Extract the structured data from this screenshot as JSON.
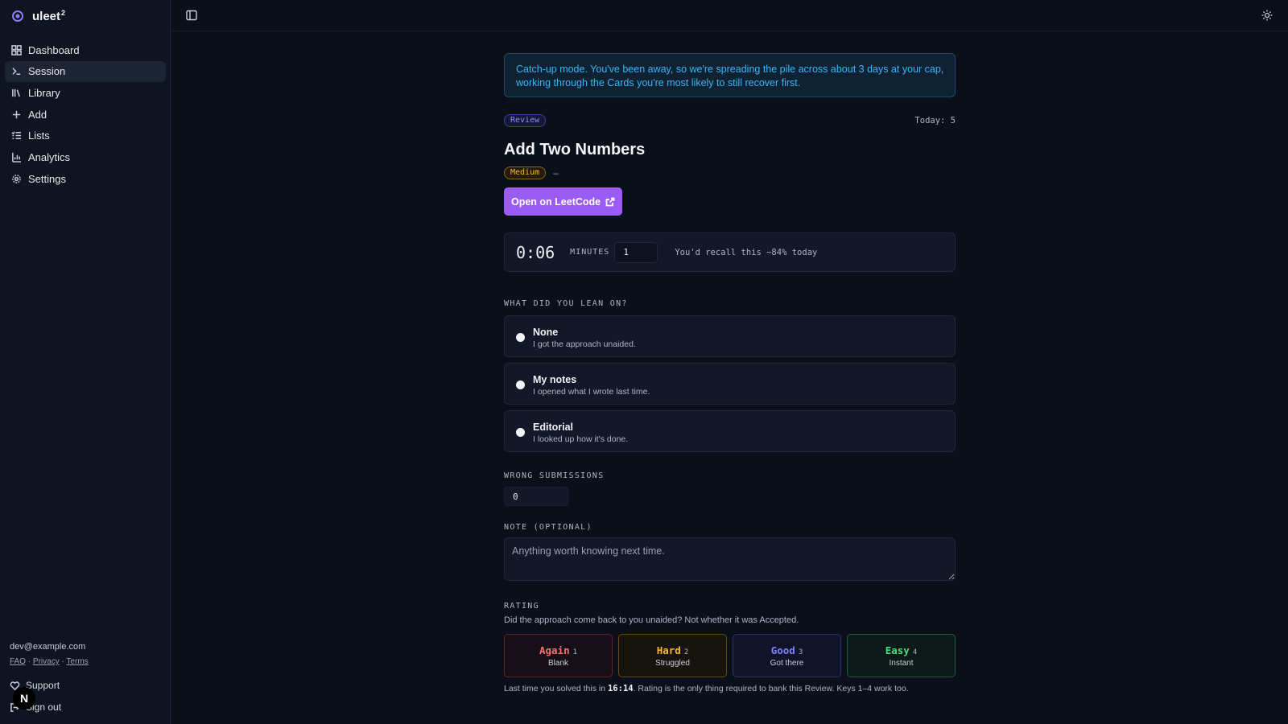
{
  "app": {
    "name": "uleet",
    "name_sup": "2"
  },
  "sidebar": {
    "items": [
      {
        "label": "Dashboard",
        "icon": "grid-icon"
      },
      {
        "label": "Session",
        "icon": "terminal-icon"
      },
      {
        "label": "Library",
        "icon": "library-icon"
      },
      {
        "label": "Add",
        "icon": "plus-icon"
      },
      {
        "label": "Lists",
        "icon": "list-icon"
      },
      {
        "label": "Analytics",
        "icon": "bar-chart-icon"
      },
      {
        "label": "Settings",
        "icon": "gear-icon"
      }
    ],
    "active": "Session",
    "email": "dev@example.com",
    "links": [
      "FAQ",
      "Privacy",
      "Terms"
    ],
    "support": "Support",
    "signout": "Sign out",
    "badge": "N"
  },
  "banner": "Catch-up mode. You've been away, so we're spreading the pile across about 3 days at your cap, working through the Cards you're most likely to still recover first.",
  "card": {
    "type_badge": "Review",
    "today": "Today: 5",
    "title": "Add Two Numbers",
    "difficulty": "Medium",
    "dash": "–",
    "open_button": "Open on LeetCode"
  },
  "timer": {
    "elapsed": "0:06",
    "minutes_label": "MINUTES",
    "minutes_value": "1",
    "recall": "You'd recall this ~84% today"
  },
  "lean": {
    "label": "WHAT DID YOU LEAN ON?",
    "options": [
      {
        "title": "None",
        "sub": "I got the approach unaided."
      },
      {
        "title": "My notes",
        "sub": "I opened what I wrote last time."
      },
      {
        "title": "Editorial",
        "sub": "I looked up how it's done."
      }
    ]
  },
  "wrong": {
    "label": "WRONG SUBMISSIONS",
    "value": "0"
  },
  "note": {
    "label": "NOTE (OPTIONAL)",
    "placeholder": "Anything worth knowing next time."
  },
  "rating": {
    "label": "RATING",
    "hint": "Did the approach come back to you unaided? Not whether it was Accepted.",
    "buttons": [
      {
        "label": "Again",
        "key": "1",
        "sub": "Blank"
      },
      {
        "label": "Hard",
        "key": "2",
        "sub": "Struggled"
      },
      {
        "label": "Good",
        "key": "3",
        "sub": "Got there"
      },
      {
        "label": "Easy",
        "key": "4",
        "sub": "Instant"
      }
    ],
    "last_prefix": "Last time you solved this in ",
    "last_time": "16:14",
    "last_suffix": ". Rating is the only thing required to bank this Review. Keys 1–4 work too."
  },
  "colors": {
    "accent": "#9b5cf6",
    "info": "#38b6f5",
    "background": "#0b0f1a"
  }
}
